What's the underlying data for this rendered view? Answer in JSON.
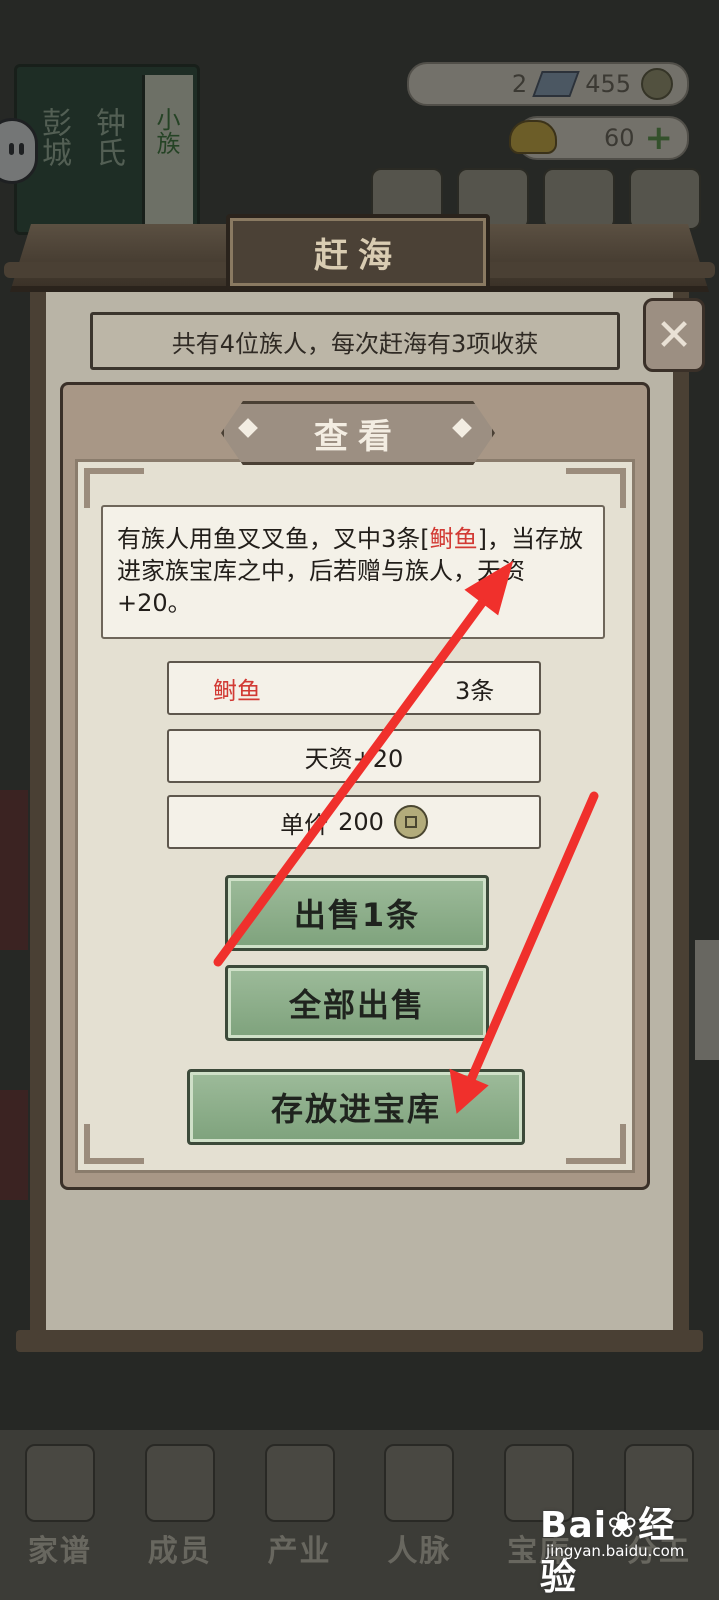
{
  "background": {
    "clan_book": {
      "surname_1": "彭城",
      "surname_2": "钟氏",
      "tag": "小族"
    },
    "resources": {
      "gems": "2",
      "coins": "455",
      "gold": "60"
    },
    "bottom_nav": [
      "家谱",
      "成员",
      "产业",
      "人脉",
      "宝库",
      "分工"
    ]
  },
  "panel": {
    "title": "赶海",
    "summary": "共有4位族人，每次赶海有3项收获",
    "close_icon": "close-icon"
  },
  "popup": {
    "title": "查看",
    "description": {
      "part1": "有族人用鱼叉叉鱼，叉中3条[",
      "highlight": "鲥鱼",
      "part2": "]，当存放进家族宝库之中，后若赠与族人，天资+20。"
    },
    "item": {
      "name": "鲥鱼",
      "quantity": "3条"
    },
    "effect": "天资+20",
    "price": {
      "label": "单价",
      "value": "200"
    },
    "buttons": {
      "sell_one": "出售1条",
      "sell_all": "全部出售",
      "store": "存放进宝库"
    }
  },
  "watermark": {
    "main": "Bai❀经验",
    "sub": "jingyan.baidu.com"
  },
  "colors": {
    "highlight_red": "#d23a34",
    "button_green": "#8fb08c",
    "arrow_red": "#f0302c"
  }
}
